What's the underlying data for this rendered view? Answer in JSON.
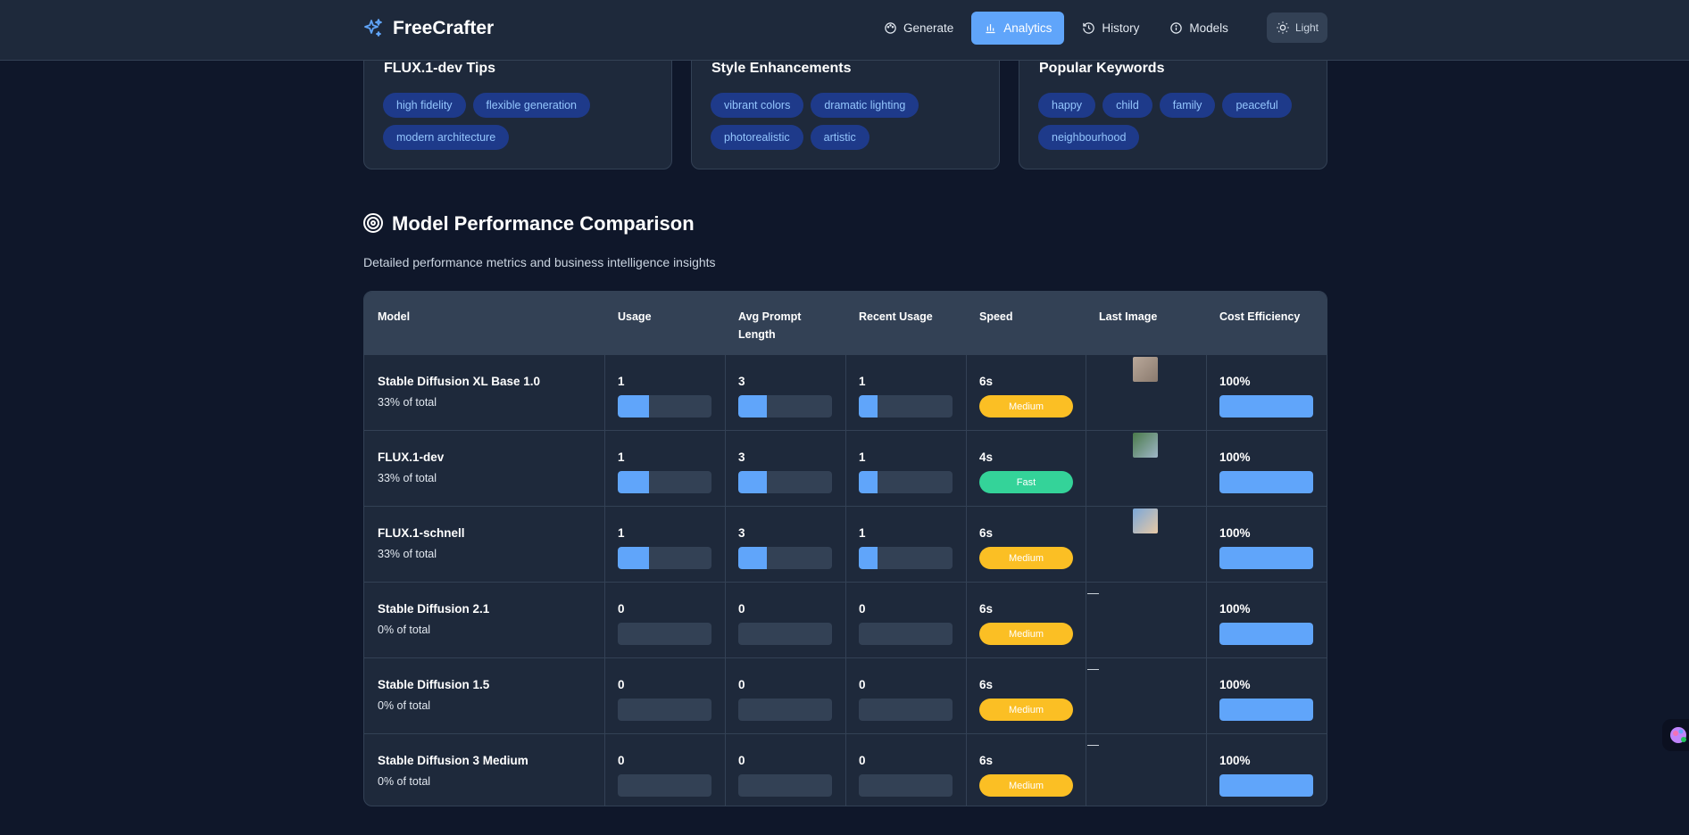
{
  "app": {
    "name": "FreeCrafter"
  },
  "nav": [
    {
      "label": "Generate",
      "icon": "palette-icon"
    },
    {
      "label": "Analytics",
      "icon": "bar-chart-icon",
      "active": true
    },
    {
      "label": "History",
      "icon": "history-icon"
    },
    {
      "label": "Models",
      "icon": "info-icon"
    }
  ],
  "theme_toggle": {
    "label": "Light",
    "icon": "sun-icon"
  },
  "cards": [
    {
      "title": "FLUX.1-dev Tips",
      "tags": [
        "high fidelity",
        "flexible generation",
        "modern architecture"
      ]
    },
    {
      "title": "Style Enhancements",
      "tags": [
        "vibrant colors",
        "dramatic lighting",
        "photorealistic",
        "artistic"
      ]
    },
    {
      "title": "Popular Keywords",
      "tags": [
        "happy",
        "child",
        "family",
        "peaceful",
        "neighbourhood"
      ]
    }
  ],
  "section": {
    "title": "Model Performance Comparison",
    "subtitle": "Detailed performance metrics and business intelligence insights"
  },
  "table": {
    "columns": [
      "Model",
      "Usage",
      "Avg Prompt Length",
      "Recent Usage",
      "Speed",
      "Last Image",
      "Cost Efficiency"
    ],
    "rows": [
      {
        "model": "Stable Diffusion XL Base 1.0",
        "share": "33% of total",
        "usage": "1",
        "usage_fill": 0.33,
        "avg_prompt": "3",
        "avg_fill": 0.3,
        "recent": "1",
        "recent_fill": 0.2,
        "speed": "6s",
        "speed_label": "Medium",
        "speed_kind": "medium",
        "last_image": "thumbnail",
        "thumb_colors": [
          "#b9a89a",
          "#8a7a6e"
        ],
        "cost": "100%",
        "cost_fill": 1.0
      },
      {
        "model": "FLUX.1-dev",
        "share": "33% of total",
        "usage": "1",
        "usage_fill": 0.33,
        "avg_prompt": "3",
        "avg_fill": 0.3,
        "recent": "1",
        "recent_fill": 0.2,
        "speed": "4s",
        "speed_label": "Fast",
        "speed_kind": "fast",
        "last_image": "thumbnail",
        "thumb_colors": [
          "#4a7a4a",
          "#9fb6c8"
        ],
        "cost": "100%",
        "cost_fill": 1.0
      },
      {
        "model": "FLUX.1-schnell",
        "share": "33% of total",
        "usage": "1",
        "usage_fill": 0.33,
        "avg_prompt": "3",
        "avg_fill": 0.3,
        "recent": "1",
        "recent_fill": 0.2,
        "speed": "6s",
        "speed_label": "Medium",
        "speed_kind": "medium",
        "last_image": "thumbnail",
        "thumb_colors": [
          "#7aa7d8",
          "#e8c9a6"
        ],
        "cost": "100%",
        "cost_fill": 1.0
      },
      {
        "model": "Stable Diffusion 2.1",
        "share": "0% of total",
        "usage": "0",
        "usage_fill": 0,
        "avg_prompt": "0",
        "avg_fill": 0,
        "recent": "0",
        "recent_fill": 0,
        "speed": "6s",
        "speed_label": "Medium",
        "speed_kind": "medium",
        "last_image": "—",
        "cost": "100%",
        "cost_fill": 1.0
      },
      {
        "model": "Stable Diffusion 1.5",
        "share": "0% of total",
        "usage": "0",
        "usage_fill": 0,
        "avg_prompt": "0",
        "avg_fill": 0,
        "recent": "0",
        "recent_fill": 0,
        "speed": "6s",
        "speed_label": "Medium",
        "speed_kind": "medium",
        "last_image": "—",
        "cost": "100%",
        "cost_fill": 1.0
      },
      {
        "model": "Stable Diffusion 3 Medium",
        "share": "0% of total",
        "usage": "0",
        "usage_fill": 0,
        "avg_prompt": "0",
        "avg_fill": 0,
        "recent": "0",
        "recent_fill": 0,
        "speed": "6s",
        "speed_label": "Medium",
        "speed_kind": "medium",
        "last_image": "—",
        "cost": "100%",
        "cost_fill": 1.0
      }
    ]
  },
  "colors": {
    "accent": "#60a5fa",
    "medium": "#fbbf24",
    "fast": "#34d399",
    "tag_bg": "#1e3a8a",
    "tag_text": "#93c5fd"
  }
}
